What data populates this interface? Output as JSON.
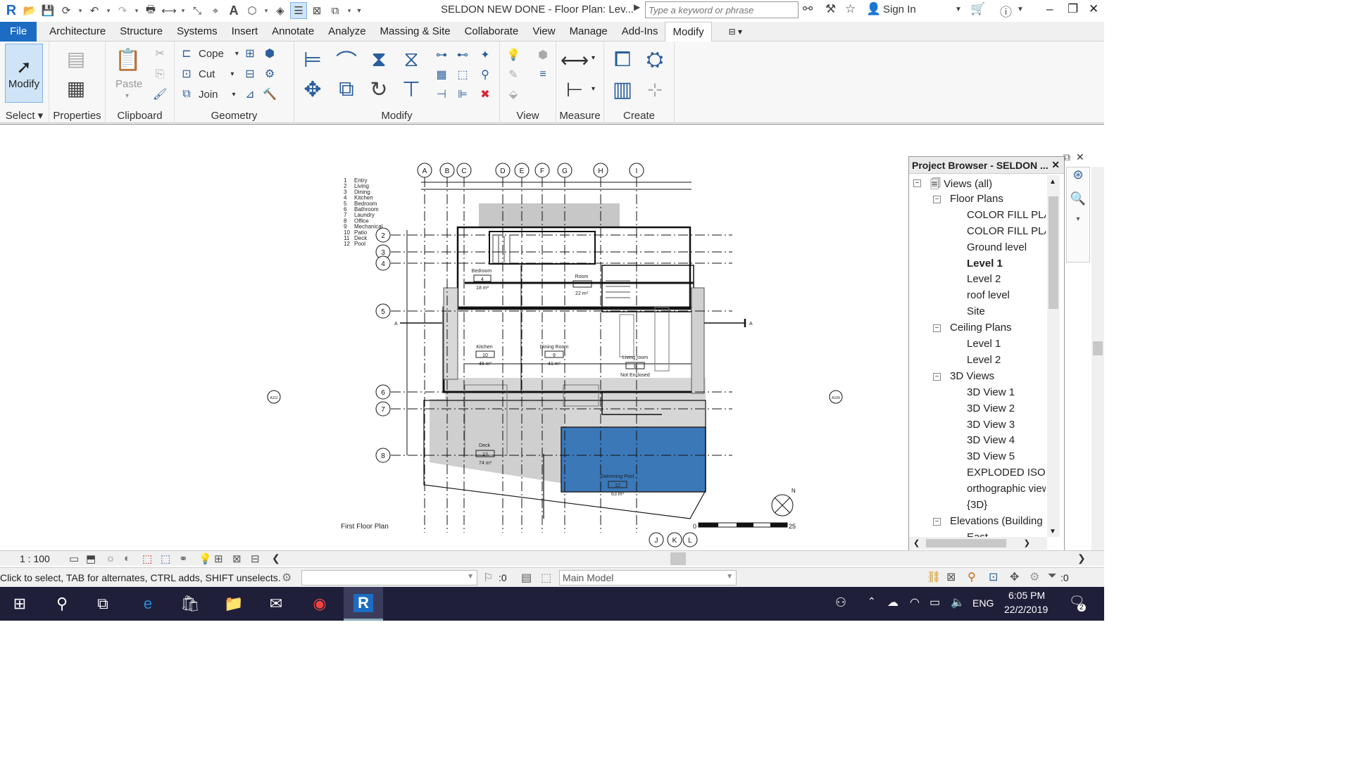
{
  "window": {
    "title": "SELDON NEW DONE - Floor Plan: Lev...",
    "search_placeholder": "Type a keyword or phrase",
    "sign_in": "Sign In"
  },
  "tabs": [
    "File",
    "Architecture",
    "Structure",
    "Systems",
    "Insert",
    "Annotate",
    "Analyze",
    "Massing & Site",
    "Collaborate",
    "View",
    "Manage",
    "Add-Ins",
    "Modify"
  ],
  "active_tab": "Modify",
  "ribbon": {
    "modify_label": "Modify",
    "paste_label": "Paste",
    "geometry_items": [
      "Cope",
      "Cut",
      "Join"
    ],
    "panels": [
      "Select",
      "Properties",
      "Clipboard",
      "Geometry",
      "Modify",
      "View",
      "Measure",
      "Create"
    ]
  },
  "drawing": {
    "grid_cols": [
      "A",
      "B",
      "C",
      "D",
      "E",
      "F",
      "G",
      "H",
      "I"
    ],
    "grid_rows": [
      "2",
      "3",
      "4",
      "5",
      "6",
      "7",
      "8"
    ],
    "grid_bottom": [
      "J",
      "K",
      "L"
    ],
    "legend": [
      {
        "num": "1",
        "name": "Entry"
      },
      {
        "num": "2",
        "name": "Living"
      },
      {
        "num": "3",
        "name": "Dining"
      },
      {
        "num": "4",
        "name": "Kitchen"
      },
      {
        "num": "5",
        "name": "Bedroom"
      },
      {
        "num": "6",
        "name": "Bathroom"
      },
      {
        "num": "7",
        "name": "Laundry"
      },
      {
        "num": "8",
        "name": "Office"
      },
      {
        "num": "9",
        "name": "Mechanical"
      },
      {
        "num": "10",
        "name": "Patio"
      },
      {
        "num": "11",
        "name": "Deck"
      },
      {
        "num": "12",
        "name": "Pool"
      }
    ],
    "rooms": [
      {
        "name": "Kitchen",
        "num": "10",
        "area": "46 m²"
      },
      {
        "name": "Dining Room",
        "num": "9",
        "area": "41 m²"
      },
      {
        "name": "Living room",
        "num": "6",
        "area": ""
      },
      {
        "name": "Not Enclosed",
        "num": "",
        "area": ""
      },
      {
        "name": "Deck",
        "num": "13",
        "area": "74 m²"
      },
      {
        "name": "Swimming Pool",
        "num": "12",
        "area": "63 m²"
      },
      {
        "name": "Bedroom",
        "num": "4",
        "area": "18 m²"
      },
      {
        "name": "Room",
        "num": "",
        "area": "22 m²"
      }
    ],
    "sheet_title": "First Floor Plan",
    "scale_start": "0",
    "scale_end": "25",
    "section_left": "A112",
    "section_right": "A109",
    "section_mark": "A"
  },
  "view_scale": "1 : 100",
  "status": {
    "text": "Click to select, TAB for alternates, CTRL adds, SHIFT unselects.",
    "counter": ":0",
    "model": "Main Model",
    "filter_count": ":0"
  },
  "project_browser": {
    "title": "Project Browser - SELDON ...",
    "root": "Views (all)",
    "groups": [
      {
        "label": "Floor Plans",
        "items": [
          "COLOR FILL PLAN",
          "COLOR FILL PLAN",
          "Ground level",
          "Level 1",
          "Level 2",
          "roof level",
          "Site"
        ]
      },
      {
        "label": "Ceiling Plans",
        "items": [
          "Level 1",
          "Level 2"
        ]
      },
      {
        "label": "3D Views",
        "items": [
          "3D View 1",
          "3D View 2",
          "3D View 3",
          "3D View 4",
          "3D View 5",
          "EXPLODED ISOMI",
          "orthographic view",
          "{3D}"
        ]
      },
      {
        "label": "Elevations (Building El",
        "items": [
          "East"
        ]
      }
    ],
    "active_item": "Level 1"
  },
  "taskbar": {
    "time": "6:05 PM",
    "date": "22/2/2019",
    "lang": "ENG",
    "notifications": "2"
  },
  "colors": {
    "file_tab": "#1b6cc2",
    "pool": "#3a78b8",
    "taskbar": "#1f1f3a"
  }
}
